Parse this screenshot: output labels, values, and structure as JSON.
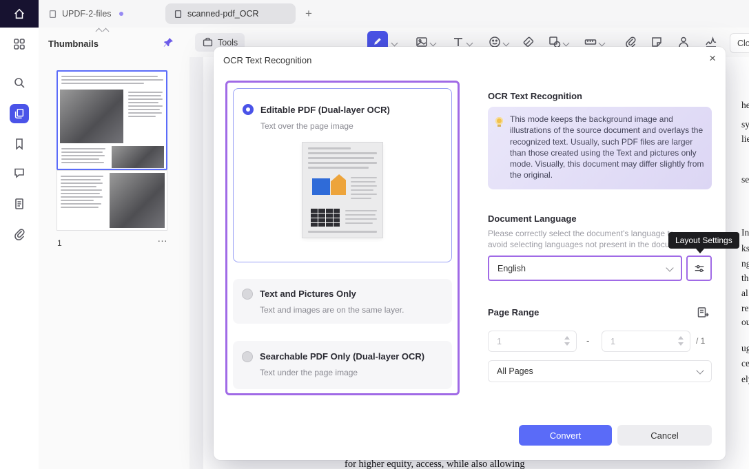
{
  "titlebar": {
    "tabs": [
      {
        "label": "UPDF-2-files"
      },
      {
        "label": "scanned-pdf_OCR"
      }
    ],
    "new_tab_label": "+"
  },
  "thumbnails_panel": {
    "title": "Thumbnails",
    "selected_page_number": "1",
    "more_label": "…"
  },
  "toolbar": {
    "tools_label": "Tools",
    "close_label": "Clos"
  },
  "ocr_dialog": {
    "title": "OCR Text Recognition",
    "close_glyph": "×",
    "options": [
      {
        "label": "Editable PDF (Dual-layer OCR)",
        "description": "Text over the page image",
        "selected": true
      },
      {
        "label": "Text and Pictures Only",
        "description": "Text and images are on the same layer.",
        "selected": false
      },
      {
        "label": "Searchable PDF Only (Dual-layer OCR)",
        "description": "Text under the page image",
        "selected": false
      }
    ],
    "settings": {
      "heading": "OCR Text Recognition",
      "info_text": "This mode keeps the background image and illustrations of the source document and overlays the recognized text. Usually, such PDF files are larger than those created using the Text and pictures only mode. Visually, this document may differ slightly from the original.",
      "document_language_label": "Document Language",
      "language_hint_line1": "Please correctly select the document's language to",
      "language_hint_line2": "avoid selecting languages not present in the document.",
      "language_value": "English",
      "layout_settings_tooltip": "Layout Settings",
      "page_range_label": "Page Range",
      "range_from": "1",
      "range_to": "1",
      "range_separator": "-",
      "range_total": "/ 1",
      "page_scope_value": "All Pages",
      "convert_label": "Convert",
      "cancel_label": "Cancel"
    },
    "accent_colors": {
      "highlight_purple": "#a06ae6",
      "primary_blue": "#4a53e8",
      "convert_button": "#5a6bf8"
    }
  },
  "background_document": {
    "right_edge_fragments": [
      "he as",
      "sy us",
      "lies. T",
      "sed",
      "In A",
      "ks a",
      "ng",
      "th",
      "al",
      "renti",
      "ou",
      "ugges",
      "ce",
      "ely u"
    ],
    "bottom_fragment": "for higher equity, access, while also allowing"
  }
}
